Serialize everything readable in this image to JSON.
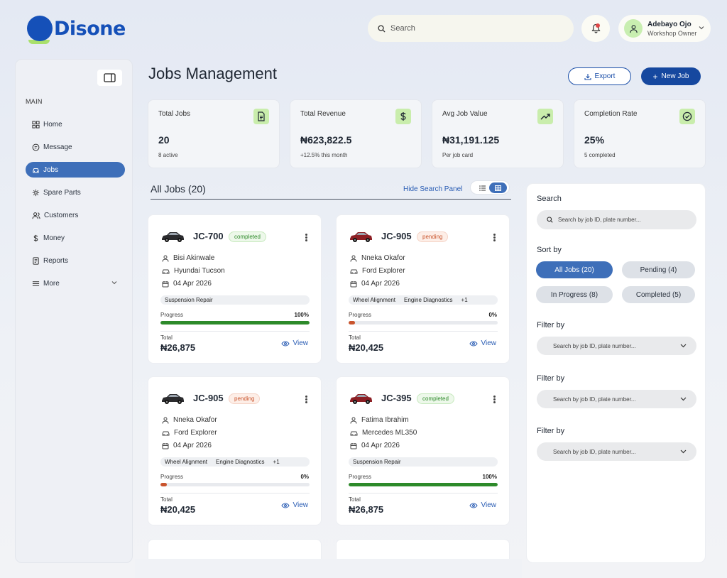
{
  "brand": {
    "name": "Disone"
  },
  "topbar": {
    "search_placeholder": "Search",
    "user": {
      "name": "Adebayo Ojo",
      "role": "Workshop Owner"
    }
  },
  "sidebar": {
    "section": "MAIN",
    "items": [
      {
        "label": "Home",
        "icon": "dashboard-icon"
      },
      {
        "label": "Message",
        "icon": "message-icon"
      },
      {
        "label": "Jobs",
        "icon": "car-icon",
        "active": true
      },
      {
        "label": "Spare Parts",
        "icon": "parts-icon"
      },
      {
        "label": "Customers",
        "icon": "users-icon"
      },
      {
        "label": "Money",
        "icon": "dollar-icon"
      },
      {
        "label": "Reports",
        "icon": "report-icon"
      },
      {
        "label": "More",
        "icon": "menu-icon"
      }
    ]
  },
  "page": {
    "title": "Jobs Management",
    "export_label": "Export",
    "new_job_label": "New Job"
  },
  "stats": [
    {
      "label": "Total Jobs",
      "value": "20",
      "sub": "8 active",
      "icon": "document-icon"
    },
    {
      "label": "Total Revenue",
      "value": "₦623,822.5",
      "sub": "+12.5% this month",
      "icon": "dollar-icon"
    },
    {
      "label": "Avg Job Value",
      "value": "₦31,191.125",
      "sub": "Per job card",
      "icon": "trending-up-icon"
    },
    {
      "label": "Completion Rate",
      "value": "25%",
      "sub": "5 completed",
      "icon": "check-circle-icon"
    }
  ],
  "jobs_section": {
    "heading": "All Jobs (20)",
    "hide_panel_label": "Hide Search Panel"
  },
  "jobs": [
    {
      "id": "JC-700",
      "status": "completed",
      "customer": "Bisi Akinwale",
      "vehicle": "Hyundai Tucson",
      "date": "04 Apr 2026",
      "tags": [
        "Suspension Repair"
      ],
      "progress_label": "Progress",
      "progress_pct": "100%",
      "progress": 1.0,
      "total_label": "Total",
      "total": "₦26,875",
      "view_label": "View",
      "car_color": "#2b2b2e"
    },
    {
      "id": "JC-905",
      "status": "pending",
      "customer": "Nneka Okafor",
      "vehicle": "Ford Explorer",
      "date": "04 Apr 2026",
      "tags": [
        "Wheel Alignment",
        "Engine Diagnostics",
        "+1"
      ],
      "progress_label": "Progress",
      "progress_pct": "0%",
      "progress": 0.0,
      "total_label": "Total",
      "total": "₦20,425",
      "view_label": "View",
      "car_color": "#8c1f24"
    },
    {
      "id": "JC-905",
      "status": "pending",
      "customer": "Nneka Okafor",
      "vehicle": "Ford Explorer",
      "date": "04 Apr 2026",
      "tags": [
        "Wheel Alignment",
        "Engine Diagnostics",
        "+1"
      ],
      "progress_label": "Progress",
      "progress_pct": "0%",
      "progress": 0.0,
      "total_label": "Total",
      "total": "₦20,425",
      "view_label": "View",
      "car_color": "#2b2b2e"
    },
    {
      "id": "JC-395",
      "status": "completed",
      "customer": "Fatima Ibrahim",
      "vehicle": "Mercedes ML350",
      "date": "04 Apr 2026",
      "tags": [
        "Suspension Repair"
      ],
      "progress_label": "Progress",
      "progress_pct": "100%",
      "progress": 1.0,
      "total_label": "Total",
      "total": "₦26,875",
      "view_label": "View",
      "car_color": "#8c1f24"
    }
  ],
  "panel": {
    "search_label": "Search",
    "search_placeholder": "Search by job ID, plate number...",
    "sort_label": "Sort by",
    "sort_options": [
      {
        "label": "All Jobs (20)",
        "active": true
      },
      {
        "label": "Pending (4)"
      },
      {
        "label": "In Progress (8)"
      },
      {
        "label": "Completed (5)"
      }
    ],
    "filters": [
      {
        "label": "Filter by",
        "placeholder": "Search by job ID, plate number..."
      },
      {
        "label": "Filter by",
        "placeholder": "Search by job ID, plate number..."
      },
      {
        "label": "Filter by",
        "placeholder": "Search by job ID, plate number..."
      }
    ]
  },
  "colors": {
    "brand": "#1550b8",
    "accent": "#3e6fb9",
    "success": "#2d8a2a",
    "pending": "#c9542d",
    "icon_bg": "#c9edac"
  }
}
